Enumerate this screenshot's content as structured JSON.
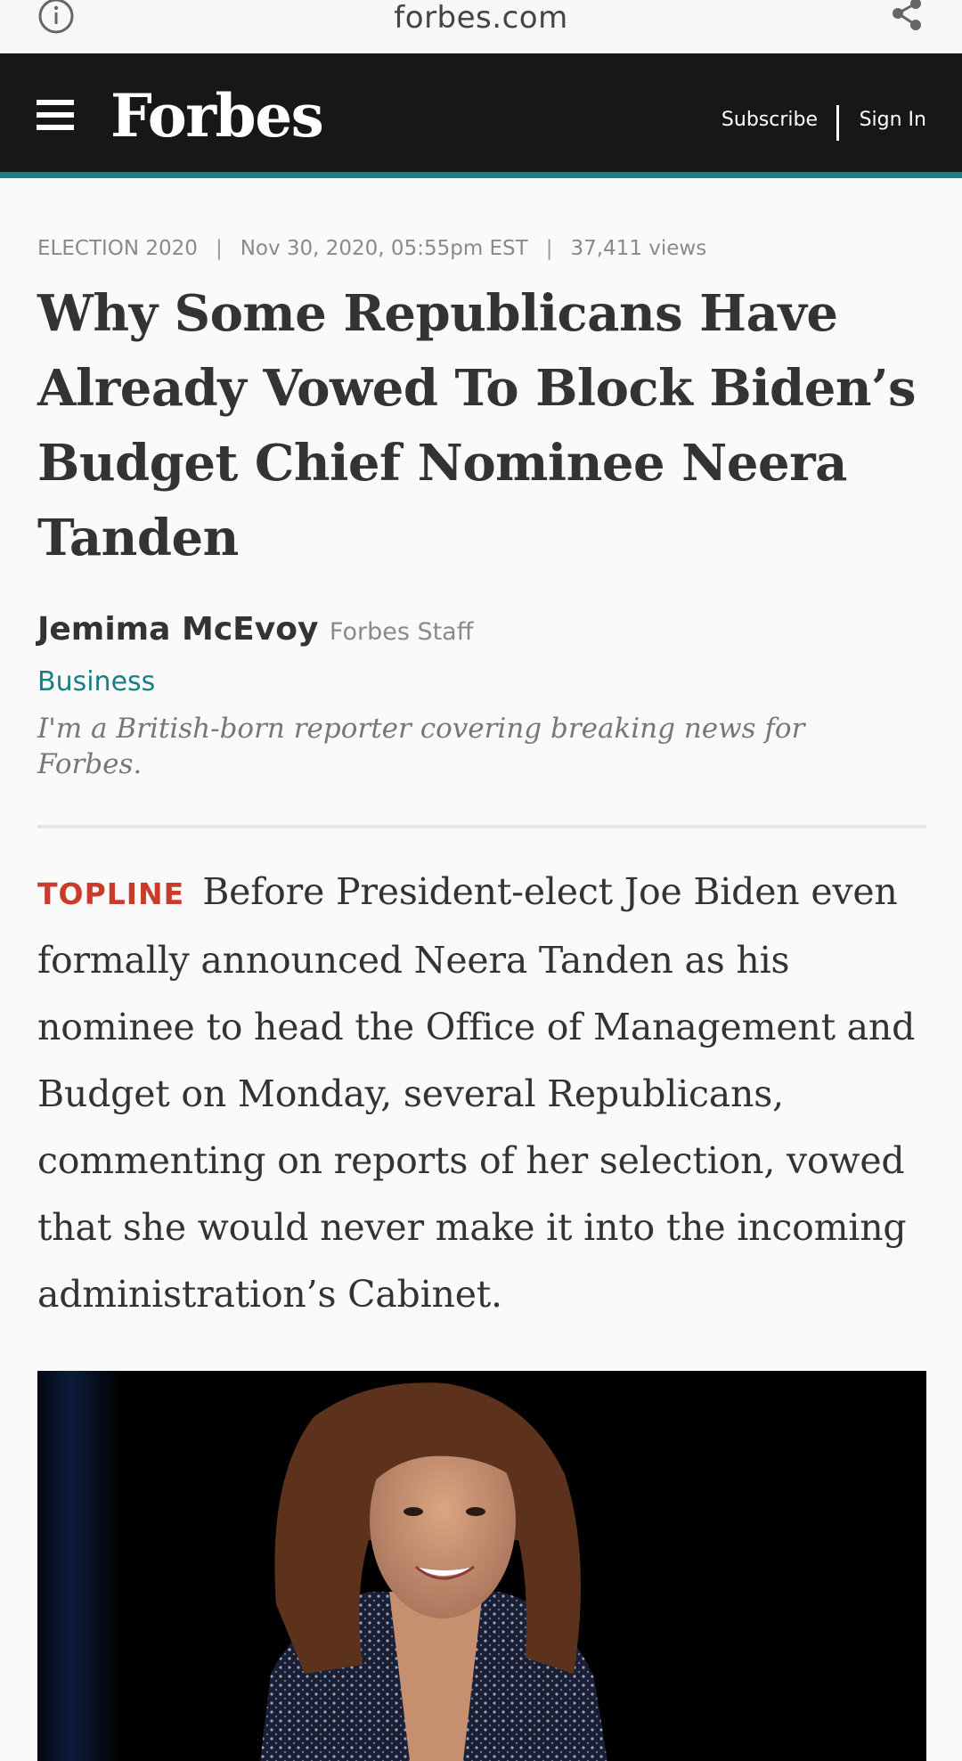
{
  "browser": {
    "url": "forbes.com"
  },
  "header": {
    "logo": "Forbes",
    "subscribe_label": "Subscribe",
    "signin_label": "Sign In",
    "accent_color": "#1a7f85"
  },
  "article": {
    "kicker": "ELECTION 2020",
    "date": "Nov 30, 2020, 05:55pm EST",
    "views": "37,411 views",
    "headline": "Why Some Republicans Have Already Vowed To Block Biden’s Budget Chief Nominee Neera Tanden",
    "author": {
      "name": "Jemima McEvoy",
      "role": "Forbes Staff",
      "section": "Business",
      "bio": "I'm a British-born reporter covering breaking news for Forbes."
    },
    "topline_label": "TOPLINE",
    "topline_text": "Before President-elect Joe Biden even formally announced Neera Tanden as his nominee to head the Office of Management and Budget on Monday, several Republicans, commenting on reports of her selection, vowed that she would never make it into the incoming administration’s Cabinet."
  }
}
